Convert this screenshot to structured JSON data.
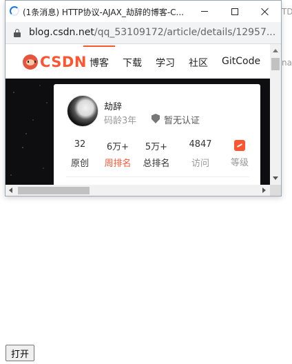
{
  "background": {
    "fragment_top": "TD",
    "fragment_mid": "nat"
  },
  "popup_window": {
    "title": "(1条消息) HTTP协议-AJAX_劫辞的博客-C...",
    "url_domain": "blog.csdn.net",
    "url_path": "/qq_53109172/article/details/12957..."
  },
  "site_nav": {
    "logo_text": "CSDN",
    "items": [
      "博客",
      "下载",
      "学习",
      "社区",
      "GitCode"
    ]
  },
  "profile_card": {
    "author_name": "劫辞",
    "code_age": "码龄3年",
    "certification": "暂无认证",
    "stats": [
      {
        "value": "32",
        "label": "原创"
      },
      {
        "value": "6万+",
        "label": "周排名"
      },
      {
        "value": "5万+",
        "label": "总排名"
      },
      {
        "value": "4847",
        "label": "访问"
      },
      {
        "value": "",
        "label": "等级"
      }
    ]
  },
  "open_button_label": "打开",
  "colors": {
    "brand": "#fc5531",
    "loading": "#1a73e8"
  }
}
